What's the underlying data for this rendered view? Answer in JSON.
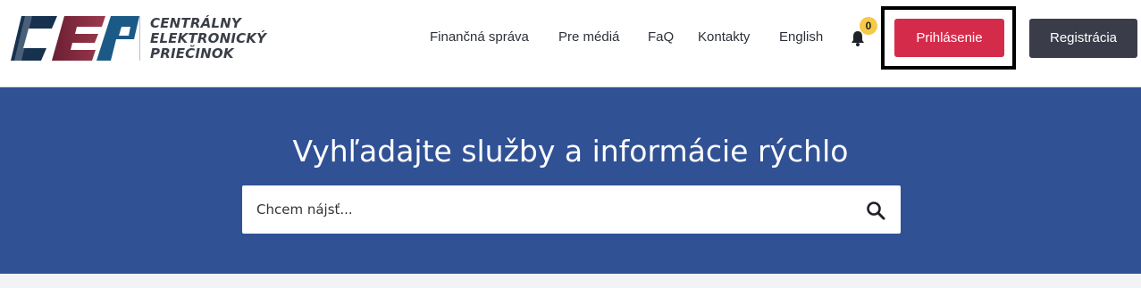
{
  "brand": {
    "logo_letters": "CEP",
    "name_lines": [
      "CENTRÁLNY",
      "ELEKTRONICKÝ",
      "PRIEČINOK"
    ]
  },
  "nav": {
    "items": [
      {
        "label": "Finančná správa"
      },
      {
        "label": "Pre médiá"
      },
      {
        "label": "FaQ"
      },
      {
        "label": "Kontakty"
      },
      {
        "label": "English"
      }
    ]
  },
  "notifications": {
    "icon": "bell-icon",
    "count": "0",
    "badge_color": "#f7c948"
  },
  "auth": {
    "login_label": "Prihlásenie",
    "register_label": "Registrácia",
    "login_color": "#d52b4a",
    "register_color": "#3a3d49"
  },
  "hero": {
    "title": "Vyhľadajte služby a informácie rýchlo",
    "background": "#315195",
    "search": {
      "placeholder": "Chcem nájsť...",
      "value": "",
      "icon": "search-icon"
    }
  }
}
